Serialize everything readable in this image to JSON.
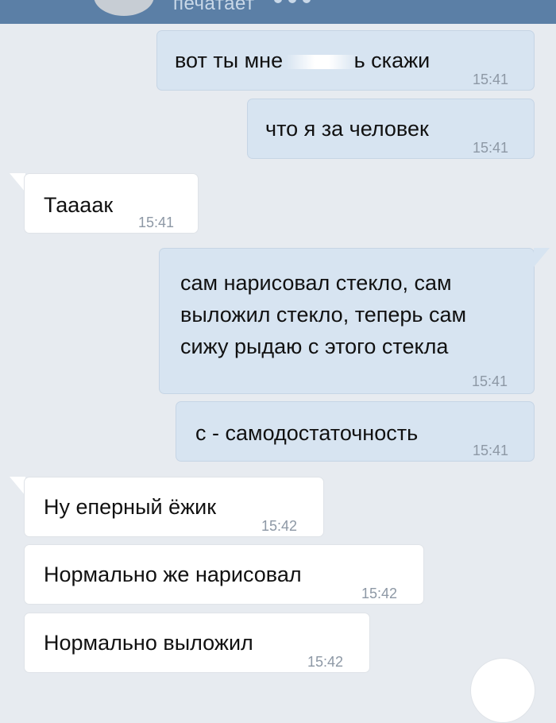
{
  "header": {
    "status_text": "печатает"
  },
  "messages": [
    {
      "dir": "out",
      "text_before": "вот ты мне ",
      "text_after": "ь скажи",
      "time": "15:41"
    },
    {
      "dir": "out",
      "text": "что я за человек",
      "time": "15:41"
    },
    {
      "dir": "in",
      "text": "Таааак",
      "time": "15:41"
    },
    {
      "dir": "out",
      "lines": [
        "сам нарисовал стекло, сам",
        "выложил стекло, теперь сам",
        "сижу рыдаю с этого стекла"
      ],
      "time": "15:41"
    },
    {
      "dir": "out",
      "text": "с - самодостаточность",
      "time": "15:41"
    },
    {
      "dir": "in",
      "text": "Ну еперный ёжик",
      "time": "15:42"
    },
    {
      "dir": "in",
      "text": "Нормально же нарисовал",
      "time": "15:42"
    },
    {
      "dir": "in",
      "text": "Нормально выложил",
      "time": "15:42"
    }
  ]
}
